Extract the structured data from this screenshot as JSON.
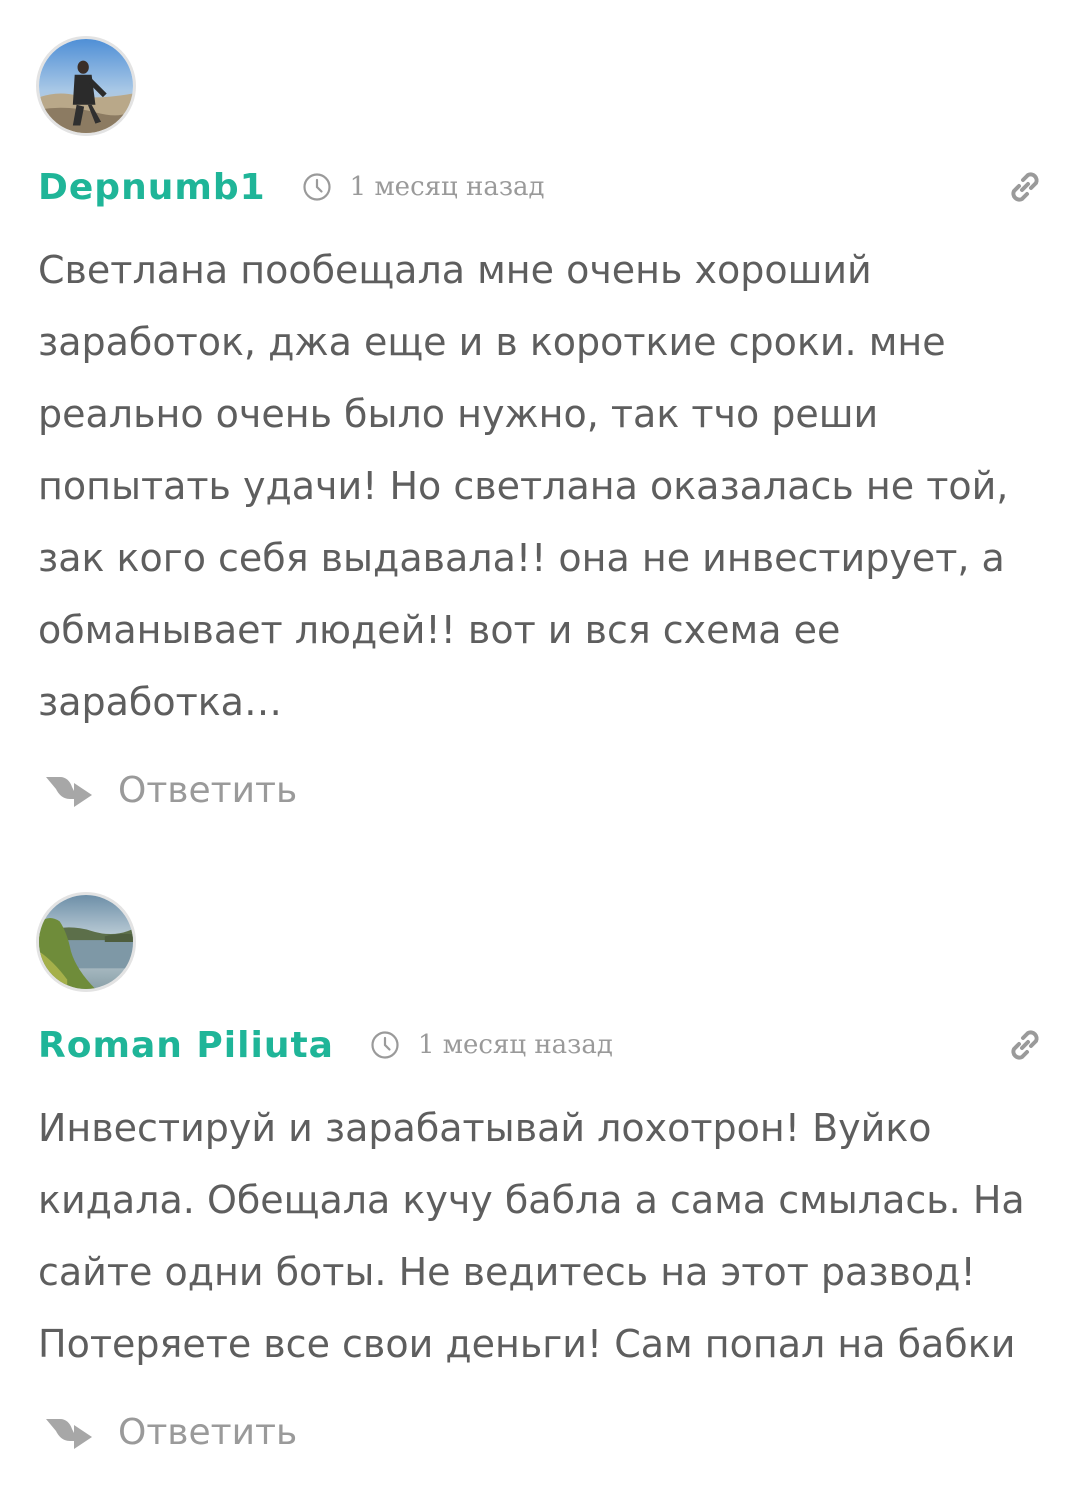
{
  "colors": {
    "author": "#1fb598",
    "text": "#5e5e5e",
    "muted": "#9a9a9a"
  },
  "comments": [
    {
      "author": "Depnumb1",
      "time": "1 месяц назад",
      "text": "Светлана пообещала мне очень хороший\nзаработок, джа еще и в короткие сроки. мне\nреально очень было нужно, так тчо реши\nпопытать удачи! Но светлана оказалась не той,\nзак кого себя выдавала!! она не инвестирует, а\nобманывает людей!! вот и вся схема ее\nзаработка…",
      "reply_label": "Ответить",
      "avatar_icon": "user-photo-icon"
    },
    {
      "author": "Roman Piliuta",
      "time": "1 месяц назад",
      "text": "Инвестируй и зарабатывай лохотрон! Вуйко\nкидала. Обещала кучу бабла а сама смылась. На\nсайте одни боты. Не ведитесь на этот развод!\nПотеряете все свои деньги! Сам попал на бабки",
      "reply_label": "Ответить",
      "avatar_icon": "landscape-photo-icon"
    }
  ]
}
